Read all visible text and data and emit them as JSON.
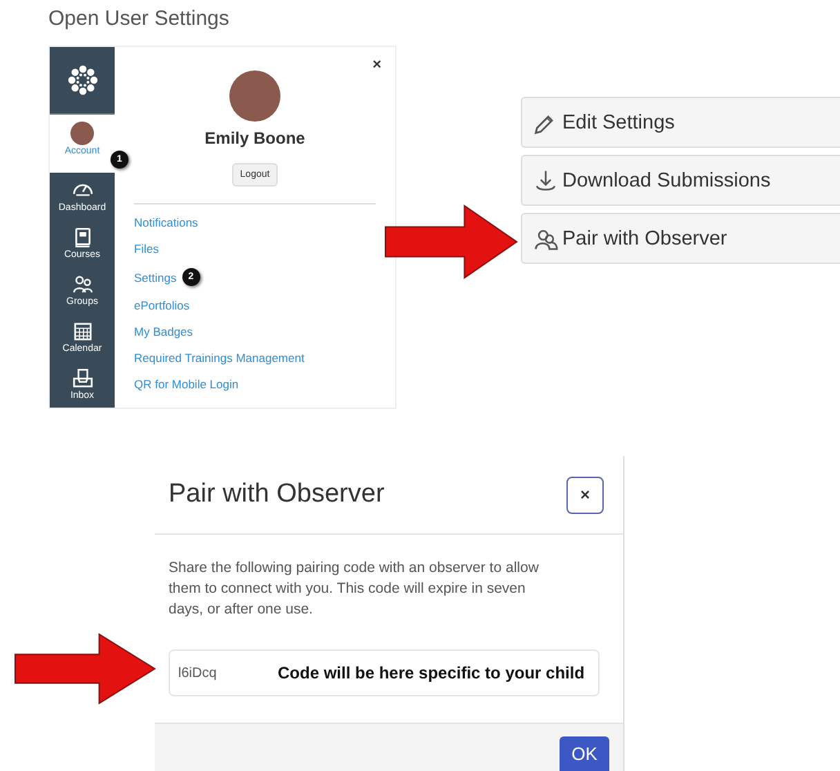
{
  "heading": "Open User Settings",
  "global_nav": {
    "items": [
      {
        "label": "Account",
        "kind": "avatar",
        "selected": true,
        "badge": "1"
      },
      {
        "label": "Dashboard",
        "kind": "dashboard",
        "selected": false
      },
      {
        "label": "Courses",
        "kind": "courses",
        "selected": false
      },
      {
        "label": "Groups",
        "kind": "groups",
        "selected": false
      },
      {
        "label": "Calendar",
        "kind": "calendar",
        "selected": false
      },
      {
        "label": "Inbox",
        "kind": "inbox",
        "selected": false
      }
    ]
  },
  "account_tray": {
    "close": "×",
    "name": "Emily Boone",
    "logout": "Logout",
    "links": [
      {
        "label": "Notifications"
      },
      {
        "label": "Files"
      },
      {
        "label": "Settings",
        "badge": "2"
      },
      {
        "label": "ePortfolios"
      },
      {
        "label": "My Badges"
      },
      {
        "label": "Required Trainings Management"
      },
      {
        "label": "QR for Mobile Login"
      }
    ]
  },
  "settings_buttons": [
    {
      "label": "Edit Settings",
      "kind": "edit"
    },
    {
      "label": "Download Submissions",
      "kind": "download"
    },
    {
      "label": "Pair with Observer",
      "kind": "pair"
    }
  ],
  "dialog": {
    "title": "Pair with Observer",
    "close": "×",
    "message": "Share the following pairing code with an observer to allow them to connect with you. This code will expire in seven days, or after one use.",
    "code": "l6iDcq",
    "annotation": "Code will be here specific to your child",
    "ok": "OK"
  }
}
